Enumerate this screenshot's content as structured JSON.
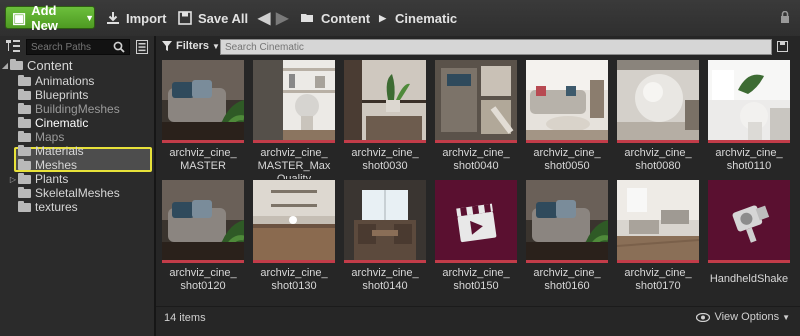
{
  "toolbar": {
    "add_new_label": "Add New",
    "import_label": "Import",
    "save_all_label": "Save All",
    "breadcrumb": [
      "Content",
      "Cinematic"
    ]
  },
  "sidebar": {
    "search_placeholder": "Search Paths",
    "root_label": "Content",
    "items": [
      {
        "label": "Animations"
      },
      {
        "label": "Blueprints"
      },
      {
        "label": "BuildingMeshes"
      },
      {
        "label": "Cinematic"
      },
      {
        "label": "Maps"
      },
      {
        "label": "Materials"
      },
      {
        "label": "Meshes"
      },
      {
        "label": "Plants"
      },
      {
        "label": "SkeletalMeshes"
      },
      {
        "label": "textures"
      }
    ]
  },
  "content": {
    "filters_label": "Filters",
    "search_placeholder": "Search Cinematic",
    "assets": [
      {
        "line1": "archviz_cine_",
        "line2": "MASTER",
        "kind": "interior-living"
      },
      {
        "line1": "archviz_cine_",
        "line2": "MASTER_Max",
        "line3": "Quality",
        "kind": "interior-shelf"
      },
      {
        "line1": "archviz_cine_",
        "line2": "shot0030",
        "kind": "interior-plant"
      },
      {
        "line1": "archviz_cine_",
        "line2": "shot0040",
        "kind": "interior-topdown"
      },
      {
        "line1": "archviz_cine_",
        "line2": "shot0050",
        "kind": "interior-sofa-wide"
      },
      {
        "line1": "archviz_cine_",
        "line2": "shot0080",
        "kind": "interior-vase"
      },
      {
        "line1": "archviz_cine_",
        "line2": "shot0110",
        "kind": "interior-bright"
      },
      {
        "line1": "archviz_cine_",
        "line2": "shot0120",
        "kind": "interior-living"
      },
      {
        "line1": "archviz_cine_",
        "line2": "shot0130",
        "kind": "interior-table"
      },
      {
        "line1": "archviz_cine_",
        "line2": "shot0140",
        "kind": "interior-dining"
      },
      {
        "line1": "archviz_cine_",
        "line2": "shot0150",
        "kind": "clapper"
      },
      {
        "line1": "archviz_cine_",
        "line2": "shot0160",
        "kind": "interior-living"
      },
      {
        "line1": "archviz_cine_",
        "line2": "shot0170",
        "kind": "interior-room"
      },
      {
        "line1": "HandheldShake",
        "kind": "camera"
      }
    ],
    "status_text": "14 items",
    "view_options_label": "View Options"
  },
  "colors": {
    "add_new_green": "#5aa82c",
    "selection_highlight": "#e8e23a",
    "asset_bar_red": "#c23c49",
    "camera_tile_bg": "#5a1030"
  }
}
